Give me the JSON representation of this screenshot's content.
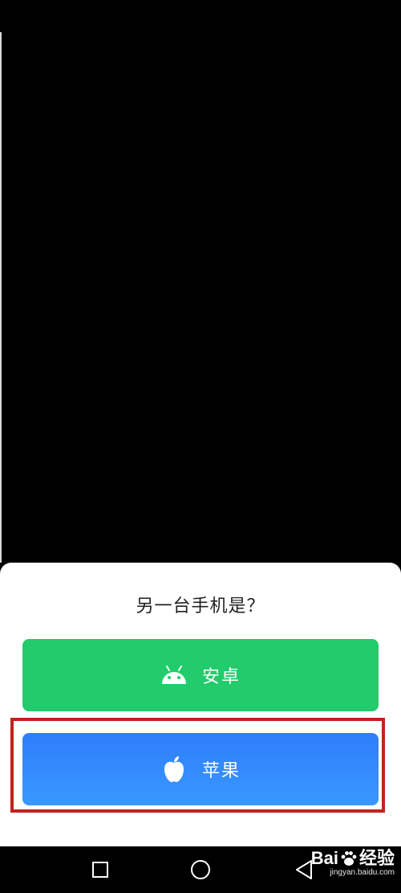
{
  "sheet": {
    "title": "另一台手机是？",
    "options": [
      {
        "label": "安卓",
        "icon": "android-icon",
        "color": "#22cc6c"
      },
      {
        "label": "苹果",
        "icon": "apple-icon",
        "color": "#3a8bfd"
      }
    ]
  },
  "annotation": {
    "highlight_color": "#c0231e"
  },
  "navbar": {
    "icons": [
      "square-recent-icon",
      "circle-home-icon",
      "triangle-back-icon"
    ]
  },
  "watermark": {
    "logo_left": "Bai",
    "logo_right": "经验",
    "url": "jingyan.baidu.com"
  }
}
